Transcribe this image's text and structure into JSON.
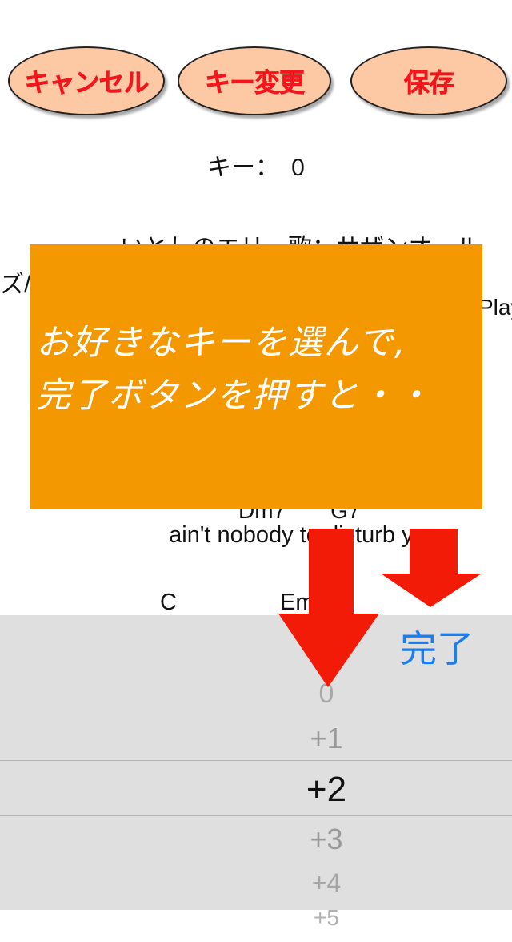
{
  "toolbar": {
    "cancel_label": "キャンセル",
    "key_change_label": "キー変更",
    "save_label": "保存"
  },
  "key": {
    "label": "キー：　0"
  },
  "song": {
    "title_line": "いとしのエリー歌：サザンオール",
    "title_wrap": "ズ/",
    "right_clip": "Play",
    "chords_1": "Dm7　　G7",
    "lyric": "ain't nobody to disturb you",
    "chord_c": "C",
    "chord_em": "Em"
  },
  "overlay": {
    "line1": "お好きなキーを選んで,",
    "line2": "完了ボタンを押すと・・"
  },
  "picker": {
    "done_label": "完了",
    "options": [
      "0",
      "+1",
      "+2",
      "+3",
      "+4",
      "+5"
    ],
    "selected": "+2"
  },
  "colors": {
    "button_fill": "#fcc9a4",
    "button_text": "#f2161c",
    "overlay": "#f39800",
    "arrow": "#f21b07",
    "done": "#1a7ef0",
    "picker_bg": "#dfdfdf"
  }
}
